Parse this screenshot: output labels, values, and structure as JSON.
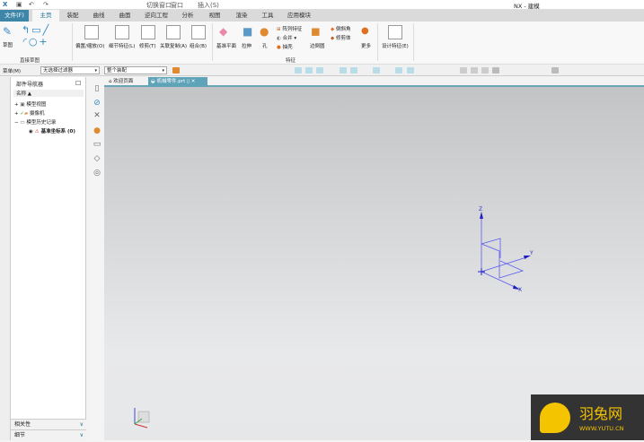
{
  "title": "NX - 建模",
  "quick_access": {
    "switch_window": "切换窗口",
    "window": "窗口",
    "insert": "插入(S)"
  },
  "tabs": [
    "文件(F)",
    "主页",
    "装配",
    "曲线",
    "曲面",
    "逆向工程",
    "分析",
    "视图",
    "渲染",
    "工具",
    "应用模块"
  ],
  "active_tab": "主页",
  "ribbon": {
    "sketch": "草图",
    "direct_sketch_group": "直接草图",
    "sync": [
      "偏置/缩放(O)",
      "细节特征(L)",
      "修剪(T)",
      "关联复制(A)",
      "组合(B)"
    ],
    "datum_plane": "基准平面",
    "extrude": "拉伸",
    "hole": "孔",
    "pattern": "阵列特征",
    "unite": "合并",
    "shell": "抽壳",
    "edge_blend": "边倒圆",
    "chamfer": "倒斜角",
    "trim_body": "修剪体",
    "more": "更多",
    "feature_group": "特征",
    "design_feature": "设计特征(E)"
  },
  "toolbar": {
    "menu": "菜单(M)",
    "filter": "无选择过滤器",
    "scope": "整个装配"
  },
  "navigator": {
    "title": "部件导航器",
    "column": "名称",
    "items": [
      "模型视图",
      "摄像机",
      "模型历史记录",
      "基准坐标系 (0)"
    ],
    "bottom": [
      "相关性",
      "细节"
    ]
  },
  "doc_tabs": [
    "欢迎页面",
    "机械零件.prt"
  ],
  "csys_labels": {
    "x": "X",
    "y": "Y",
    "z": "Z"
  },
  "watermark": {
    "name": "羽兔网",
    "url": "WWW.YUTU.CN"
  },
  "colors": {
    "accent": "#3d86a8",
    "csys": "#4a4ae0"
  }
}
